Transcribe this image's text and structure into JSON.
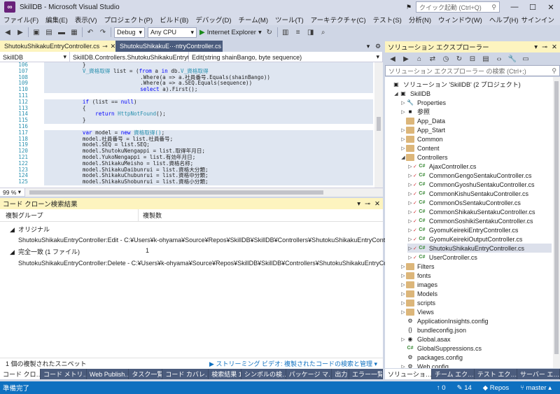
{
  "app": {
    "title": "SkillDB - Microsoft Visual Studio",
    "quick_launch": "クイック起動 (Ctrl+Q)"
  },
  "menu": [
    "ファイル(F)",
    "編集(E)",
    "表示(V)",
    "プロジェクト(P)",
    "ビルド(B)",
    "デバッグ(D)",
    "チーム(M)",
    "ツール(T)",
    "アーキテクチャ(C)",
    "テスト(S)",
    "分析(N)",
    "ウィンドウ(W)",
    "ヘルプ(H)"
  ],
  "signin": "サインイン",
  "toolbar": {
    "config": "Debug",
    "platform": "Any CPU",
    "run": "Internet Explorer"
  },
  "editor_tabs": [
    {
      "label": "ShutokuShikakuEntryController.cs",
      "close": "✕"
    },
    {
      "label": "ShutokuShikakuE···ntryController.cs",
      "close": ""
    }
  ],
  "navbar": {
    "project": "SkillDB",
    "class": "SkillDB.Controllers.ShutokuShikakuEntryt",
    "member": "Edit(string shainBango, byte sequence)"
  },
  "code_lines": [
    {
      "n": "106",
      "t": "            }"
    },
    {
      "n": "107",
      "t": "            V_資格取得 list = (from a in db.V_資格取得"
    },
    {
      "n": "108",
      "t": "                              .Where(a => a.社員番号.Equals(shainBango))"
    },
    {
      "n": "109",
      "t": "                              .Where(a => a.SEQ.Equals(sequence))"
    },
    {
      "n": "110",
      "t": "                              select a).First();"
    },
    {
      "n": "111",
      "t": ""
    },
    {
      "n": "112",
      "t": "            if (list == null)"
    },
    {
      "n": "113",
      "t": "            {"
    },
    {
      "n": "114",
      "t": "                return HttpNotFound();"
    },
    {
      "n": "115",
      "t": "            }"
    },
    {
      "n": "116",
      "t": ""
    },
    {
      "n": "117",
      "t": "            var model = new 資格取得();"
    },
    {
      "n": "118",
      "t": "            model.社員番号 = list.社員番号;"
    },
    {
      "n": "119",
      "t": "            model.SEQ = list.SEQ;"
    },
    {
      "n": "120",
      "t": "            model.ShutokuNengappi = list.取得年月日;"
    },
    {
      "n": "121",
      "t": "            model.YukoNengappi = list.有効年月日;"
    },
    {
      "n": "122",
      "t": "            model.ShikakuMeisho = list.資格名称;"
    },
    {
      "n": "123",
      "t": "            model.ShikakuDaibunrui = list.資格大分類;"
    },
    {
      "n": "124",
      "t": "            model.ShikakuChubunrui = list.資格中分類;"
    },
    {
      "n": "125",
      "t": "            model.ShikakuShobunrui = list.資格小分類;"
    }
  ],
  "zoom": "99 %",
  "clone_panel": {
    "title": "コード クローン検索結果",
    "col_group": "複製グループ",
    "col_count": "複製数",
    "group1": "オリジナル",
    "row1": "ShutokuShikakuEntryController:Edit - C:¥Users¥k-ohyama¥Source¥Repos¥SkillDB¥SkillDB¥Controllers¥ShutokuShikakuEntryControll",
    "group2": "完全一致 (1 ファイル)",
    "group2_count": "1",
    "row2": "ShutokuShikakuEntryController:Delete - C:¥Users¥k-ohyama¥Source¥Repos¥SkillDB¥SkillDB¥Controllers¥ShutokuShikakuEntryControlle",
    "footer_left": "1 個の複製されたスニペット",
    "footer_link": "ストリーミング ビデオ: 複製されたコードの検索と管理"
  },
  "bottom_tabs": [
    "コード クロ…",
    "コード メトリ…",
    "Web Publish…",
    "タスク一覧",
    "コード カバレ…",
    "検索結果 1",
    "シンボルの検…",
    "パッケージ マ…",
    "出力",
    "エラー一覧"
  ],
  "solution": {
    "title": "ソリューション エクスプローラー",
    "search_placeholder": "ソリューション エクスプローラー の検索 (Ctrl+;)",
    "items": [
      {
        "label": "ソリューション 'SkillDB' (2 プロジェクト)",
        "lvl": 0,
        "icon": "sln",
        "arrow": ""
      },
      {
        "label": "SkillDB",
        "lvl": 1,
        "icon": "proj",
        "arrow": "◢"
      },
      {
        "label": "Properties",
        "lvl": 2,
        "icon": "wrench",
        "arrow": "▷"
      },
      {
        "label": "参照",
        "lvl": 2,
        "icon": "ref",
        "arrow": "▷"
      },
      {
        "label": "App_Data",
        "lvl": 2,
        "icon": "folder",
        "arrow": ""
      },
      {
        "label": "App_Start",
        "lvl": 2,
        "icon": "folder",
        "arrow": "▷"
      },
      {
        "label": "Common",
        "lvl": 2,
        "icon": "folder",
        "arrow": "▷"
      },
      {
        "label": "Content",
        "lvl": 2,
        "icon": "folder",
        "arrow": "▷"
      },
      {
        "label": "Controllers",
        "lvl": 2,
        "icon": "folder",
        "arrow": "◢"
      },
      {
        "label": "AjaxController.cs",
        "lvl": 3,
        "icon": "cs",
        "arrow": "▷"
      },
      {
        "label": "CommonGengoSentakuController.cs",
        "lvl": 3,
        "icon": "cs",
        "arrow": "▷"
      },
      {
        "label": "CommonGyoshuSentakuController.cs",
        "lvl": 3,
        "icon": "cs",
        "arrow": "▷"
      },
      {
        "label": "CommonKishuSentakuController.cs",
        "lvl": 3,
        "icon": "cs",
        "arrow": "▷"
      },
      {
        "label": "CommonOsSentakuController.cs",
        "lvl": 3,
        "icon": "cs",
        "arrow": "▷"
      },
      {
        "label": "CommonShikakuSentakuController.cs",
        "lvl": 3,
        "icon": "cs",
        "arrow": "▷"
      },
      {
        "label": "CommonSoshikiSentakuController.cs",
        "lvl": 3,
        "icon": "cs",
        "arrow": "▷"
      },
      {
        "label": "GyomuKeirekiEntryController.cs",
        "lvl": 3,
        "icon": "cs",
        "arrow": "▷"
      },
      {
        "label": "GyomuKeirekiOutputController.cs",
        "lvl": 3,
        "icon": "cs",
        "arrow": "▷"
      },
      {
        "label": "ShutokuShikakuEntryController.cs",
        "lvl": 3,
        "icon": "cs",
        "arrow": "▷",
        "selected": true
      },
      {
        "label": "UserController.cs",
        "lvl": 3,
        "icon": "cs",
        "arrow": "▷"
      },
      {
        "label": "Filters",
        "lvl": 2,
        "icon": "folder",
        "arrow": "▷"
      },
      {
        "label": "fonts",
        "lvl": 2,
        "icon": "folder",
        "arrow": "▷"
      },
      {
        "label": "images",
        "lvl": 2,
        "icon": "folder",
        "arrow": "▷"
      },
      {
        "label": "Models",
        "lvl": 2,
        "icon": "folder",
        "arrow": "▷"
      },
      {
        "label": "scripts",
        "lvl": 2,
        "icon": "folder",
        "arrow": "▷"
      },
      {
        "label": "Views",
        "lvl": 2,
        "icon": "folder",
        "arrow": "▷"
      },
      {
        "label": "ApplicationInsights.config",
        "lvl": 2,
        "icon": "config",
        "arrow": ""
      },
      {
        "label": "bundleconfig.json",
        "lvl": 2,
        "icon": "json",
        "arrow": ""
      },
      {
        "label": "Global.asax",
        "lvl": 2,
        "icon": "asax",
        "arrow": "▷"
      },
      {
        "label": "GlobalSuppressions.cs",
        "lvl": 2,
        "icon": "cs",
        "arrow": ""
      },
      {
        "label": "packages.config",
        "lvl": 2,
        "icon": "config",
        "arrow": ""
      },
      {
        "label": "Web.config",
        "lvl": 2,
        "icon": "config",
        "arrow": "▷"
      }
    ],
    "bottom_tabs": [
      "ソリューショ…",
      "チーム エク…",
      "テスト エク…",
      "サーバー エ…"
    ]
  },
  "status": {
    "left": "準備完了",
    "up": "0",
    "edits": "14",
    "repos": "Repos",
    "branch": "master"
  },
  "colors": {
    "accent": "#0e70c0",
    "tab_active": "#fdf4bf",
    "tab_inactive": "#4b5c7d",
    "chrome": "#cfd6e5"
  }
}
